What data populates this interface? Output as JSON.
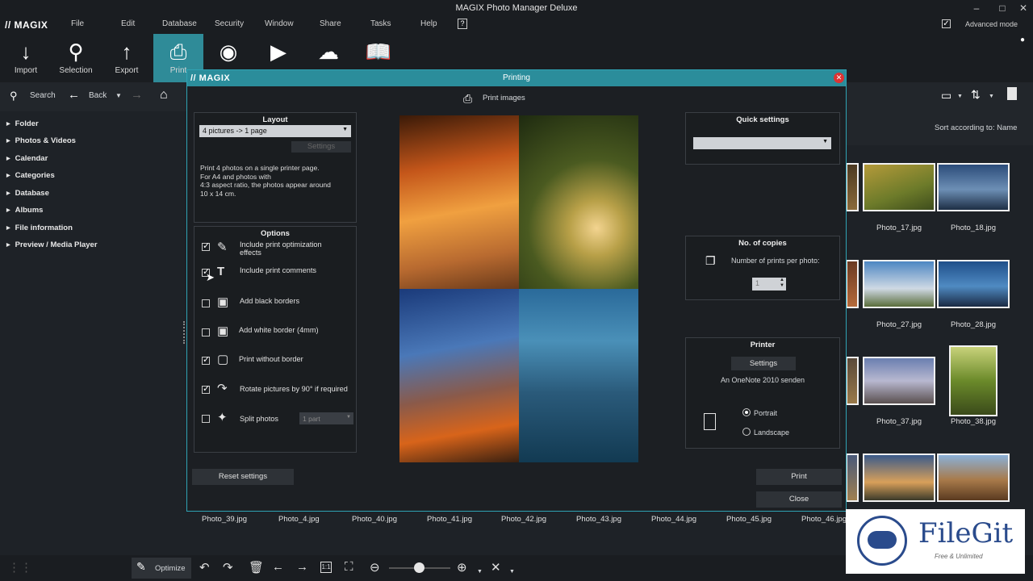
{
  "app": {
    "title": "MAGIX Photo Manager Deluxe",
    "logo": "// MAGIX"
  },
  "menu": [
    "File",
    "Edit",
    "Database",
    "Security",
    "Window",
    "Share",
    "Tasks",
    "Help"
  ],
  "advanced_mode": "Advanced mode",
  "toolbar": [
    {
      "label": "Import",
      "icon": "download-icon"
    },
    {
      "label": "Selection",
      "icon": "search-icon"
    },
    {
      "label": "Export",
      "icon": "upload-icon"
    },
    {
      "label": "Print",
      "icon": "printer-icon"
    },
    {
      "label": "",
      "icon": "disc-icon"
    },
    {
      "label": "",
      "icon": "play-icon"
    },
    {
      "label": "",
      "icon": "cloud-icon"
    },
    {
      "label": "",
      "icon": "book-icon"
    }
  ],
  "nav": {
    "search": "Search",
    "back": "Back"
  },
  "sidebar": [
    "Folder",
    "Photos & Videos",
    "Calendar",
    "Categories",
    "Database",
    "Albums",
    "File information",
    "Preview / Media Player"
  ],
  "sort": "Sort according to: Name",
  "thumbs": [
    {
      "name": "Photo_17.jpg"
    },
    {
      "name": "Photo_18.jpg"
    },
    {
      "name": "Photo_27.jpg"
    },
    {
      "name": "Photo_28.jpg"
    },
    {
      "name": "Photo_37.jpg"
    },
    {
      "name": "Photo_38.jpg"
    }
  ],
  "filestrip": [
    "Photo_39.jpg",
    "Photo_4.jpg",
    "Photo_40.jpg",
    "Photo_41.jpg",
    "Photo_42.jpg",
    "Photo_43.jpg",
    "Photo_44.jpg",
    "Photo_45.jpg",
    "Photo_46.jpg"
  ],
  "bottom": {
    "optimize": "Optimize",
    "ratio": "1:1"
  },
  "dialog": {
    "logo": "// MAGIX",
    "title": "Printing",
    "print_images": "Print images",
    "layout": {
      "head": "Layout",
      "select": "4 pictures -> 1 page",
      "settings": "Settings",
      "desc": [
        "Print 4 photos on a single printer page.",
        "For A4 and photos with",
        "4:3 aspect ratio, the photos appear around",
        "10 x 14 cm."
      ]
    },
    "options": {
      "head": "Options",
      "items": [
        {
          "label": "Include print optimization effects",
          "checked": true,
          "icon": "pen-icon"
        },
        {
          "label": "Include print comments",
          "checked": true,
          "icon": "text-icon"
        },
        {
          "label": "Add black borders",
          "checked": false,
          "icon": "border-icon"
        },
        {
          "label": "Add white border (4mm)",
          "checked": false,
          "icon": "border-icon"
        },
        {
          "label": "Print without border",
          "checked": true,
          "icon": "frame-icon"
        },
        {
          "label": "Rotate pictures by 90° if required",
          "checked": true,
          "icon": "rotate-icon"
        },
        {
          "label": "Split photos",
          "checked": false,
          "icon": "split-icon"
        }
      ],
      "split_value": "1 part"
    },
    "quick": {
      "head": "Quick settings"
    },
    "copies": {
      "head": "No. of copies",
      "label": "Number of prints per photo:",
      "value": "1"
    },
    "printer": {
      "head": "Printer",
      "settings": "Settings",
      "name": "An OneNote 2010 senden",
      "portrait": "Portrait",
      "landscape": "Landscape",
      "orientation": "Portrait"
    },
    "reset": "Reset settings",
    "print": "Print",
    "close": "Close"
  },
  "watermark": {
    "brand": "FileGit",
    "tagline": "Free & Unlimited"
  }
}
